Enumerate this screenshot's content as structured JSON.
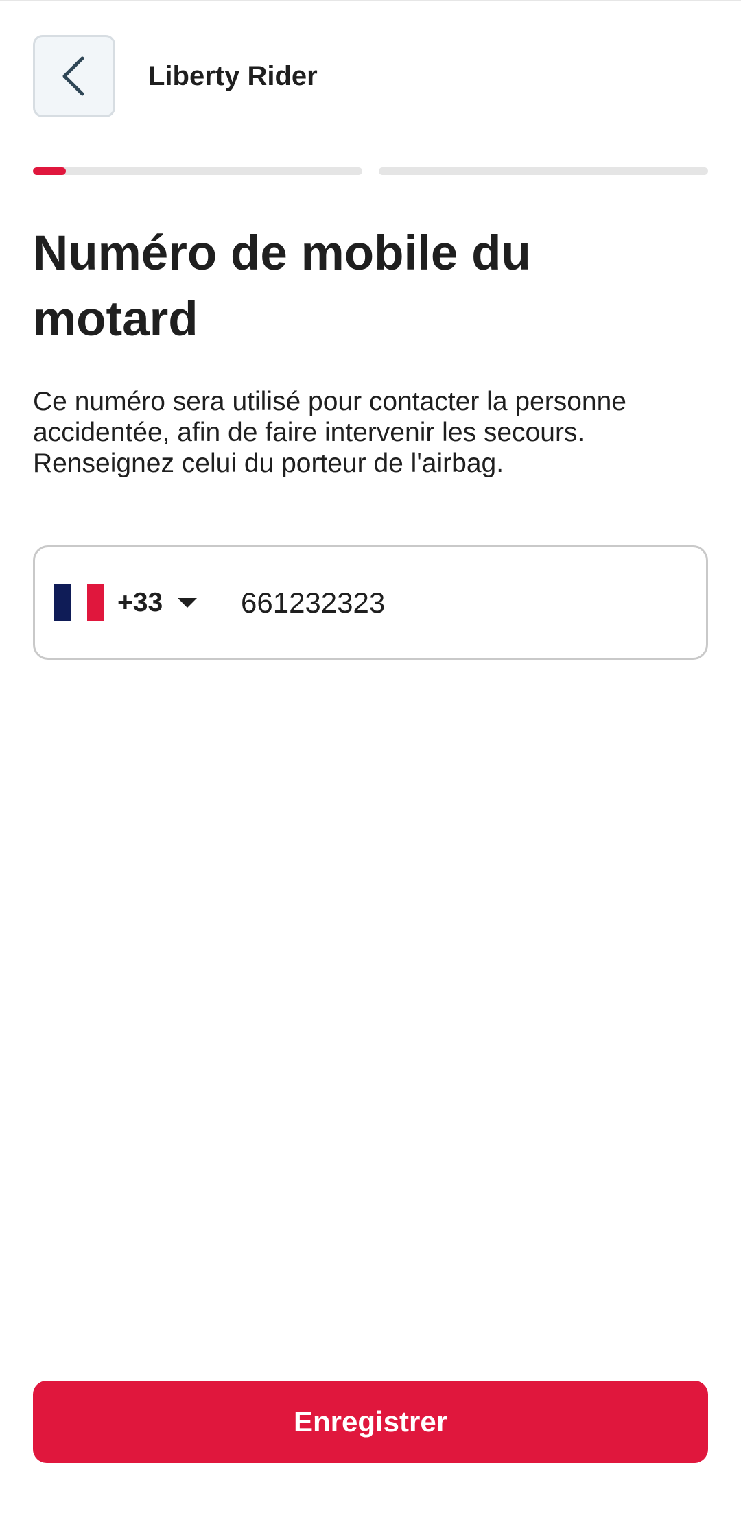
{
  "header": {
    "title": "Liberty Rider",
    "back_icon": "chevron-left-icon"
  },
  "progress": {
    "steps": [
      {
        "fill_percent": 10
      },
      {
        "fill_percent": 0
      }
    ],
    "accent_color": "#e0173d"
  },
  "main": {
    "title": "Numéro de mobile du motard",
    "description": "Ce numéro sera utilisé pour contacter la personne accidentée, afin de faire intervenir les secours. Renseignez celui du porteur de l'airbag."
  },
  "phone": {
    "country_flag": "france-flag-icon",
    "dial_code": "+33",
    "value": "661232323",
    "dropdown_icon": "caret-down-icon"
  },
  "footer": {
    "save_label": "Enregistrer",
    "button_color": "#e0173d"
  }
}
